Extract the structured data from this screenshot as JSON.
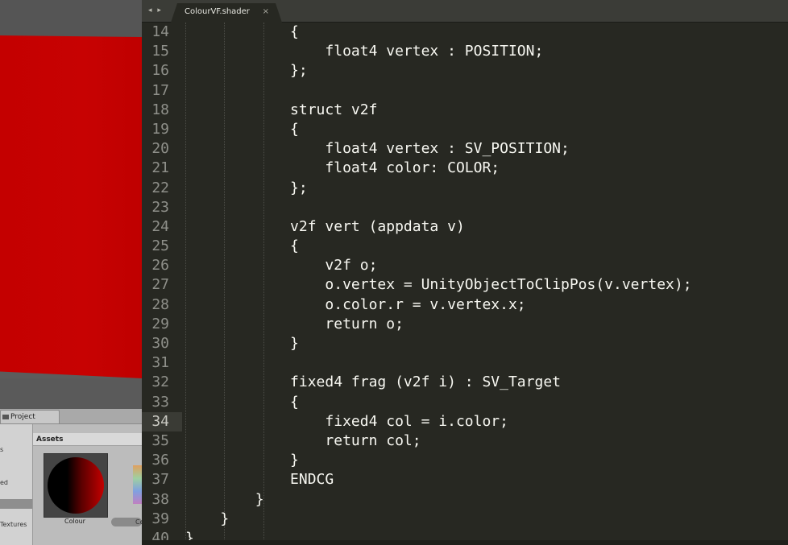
{
  "editor": {
    "nav_arrows": "◂ ▸",
    "tab_title": "ColourVF.shader",
    "tab_close": "×",
    "current_line": 34,
    "lines": [
      {
        "num": "14",
        "text": "            {"
      },
      {
        "num": "15",
        "text": "                float4 vertex : POSITION;"
      },
      {
        "num": "16",
        "text": "            };"
      },
      {
        "num": "17",
        "text": ""
      },
      {
        "num": "18",
        "text": "            struct v2f"
      },
      {
        "num": "19",
        "text": "            {"
      },
      {
        "num": "20",
        "text": "                float4 vertex : SV_POSITION;"
      },
      {
        "num": "21",
        "text": "                float4 color: COLOR;"
      },
      {
        "num": "22",
        "text": "            };"
      },
      {
        "num": "23",
        "text": ""
      },
      {
        "num": "24",
        "text": "            v2f vert (appdata v)"
      },
      {
        "num": "25",
        "text": "            {"
      },
      {
        "num": "26",
        "text": "                v2f o;"
      },
      {
        "num": "27",
        "text": "                o.vertex = UnityObjectToClipPos(v.vertex);"
      },
      {
        "num": "28",
        "text": "                o.color.r = v.vertex.x;"
      },
      {
        "num": "29",
        "text": "                return o;"
      },
      {
        "num": "30",
        "text": "            }"
      },
      {
        "num": "31",
        "text": ""
      },
      {
        "num": "32",
        "text": "            fixed4 frag (v2f i) : SV_Target"
      },
      {
        "num": "33",
        "text": "            {"
      },
      {
        "num": "34",
        "text": "                fixed4 col = i.color;"
      },
      {
        "num": "35",
        "text": "                return col;"
      },
      {
        "num": "36",
        "text": "            }"
      },
      {
        "num": "37",
        "text": "            ENDCG"
      },
      {
        "num": "38",
        "text": "        }"
      },
      {
        "num": "39",
        "text": "    }"
      },
      {
        "num": "40",
        "text": "}"
      }
    ]
  },
  "unity": {
    "project_tab": "Project",
    "assets_header": "Assets",
    "tree_items": [
      "s",
      "ed",
      "Textures"
    ],
    "asset_label": "Colour",
    "slider_label": "Co",
    "colors": {
      "scene_red": "#c40000",
      "editor_bg": "#272822"
    }
  }
}
